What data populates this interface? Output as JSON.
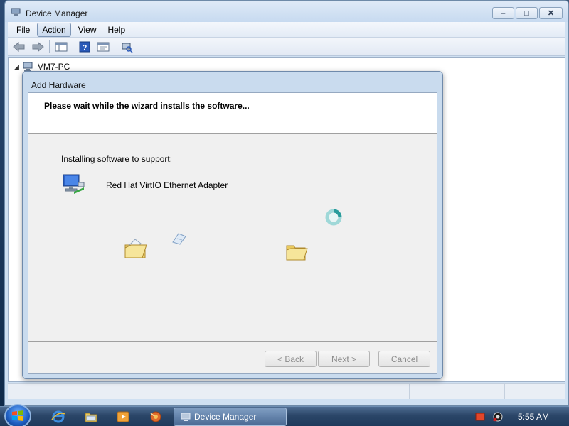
{
  "window": {
    "title": "Device Manager",
    "minimize_icon": "minimize-icon",
    "maximize_icon": "restore-icon",
    "close_icon": "close-icon"
  },
  "menu": {
    "items": [
      "File",
      "Action",
      "View",
      "Help"
    ],
    "active_index": 1
  },
  "toolbar": {
    "icons": [
      "back-arrow-icon",
      "forward-arrow-icon",
      "show-hide-console-tree-icon",
      "help-icon",
      "properties-icon",
      "scan-hardware-icon"
    ]
  },
  "tree": {
    "root_label": "VM7-PC"
  },
  "dialog": {
    "title": "Add Hardware",
    "heading": "Please wait while the wizard installs the software...",
    "installing_label": "Installing software to support:",
    "device_name": "Red Hat VirtIO Ethernet Adapter",
    "buttons": {
      "back": "< Back",
      "next": "Next >",
      "cancel": "Cancel"
    }
  },
  "taskbar": {
    "task_label": "Device Manager",
    "clock": "5:55 AM"
  },
  "colors": {
    "accent": "#2b4668",
    "dialog_frame": "#c9dbee"
  }
}
